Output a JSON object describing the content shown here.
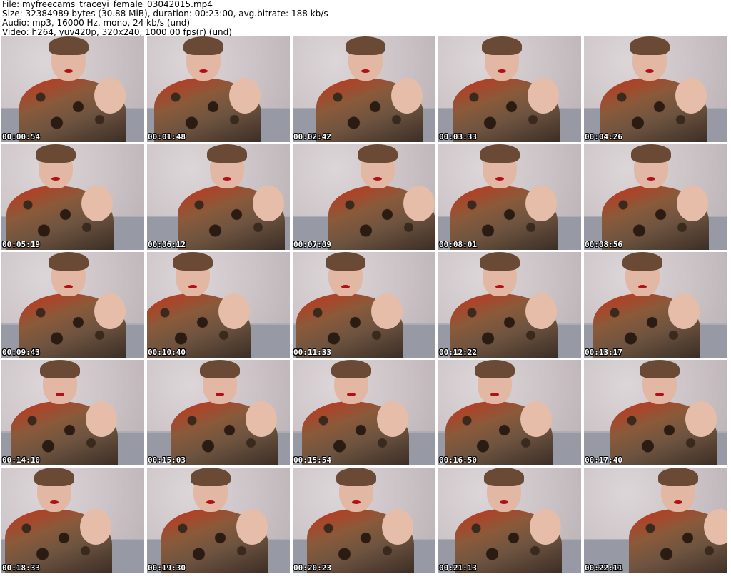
{
  "header": {
    "file_line": "File: myfreecams_traceyi_female_03042015.mp4",
    "size_line": "Size: 32384989 bytes (30.88 MiB), duration: 00:23:00, avg.bitrate: 188 kb/s",
    "audio_line": "Audio: mp3, 16000 Hz, mono, 24 kb/s (und)",
    "video_line": "Video: h264, yuv420p, 320x240, 1000.00 fps(r) (und)"
  },
  "thumbnails": [
    {
      "timestamp": "00:00:54"
    },
    {
      "timestamp": "00:01:48"
    },
    {
      "timestamp": "00:02:42"
    },
    {
      "timestamp": "00:03:33"
    },
    {
      "timestamp": "00:04:26"
    },
    {
      "timestamp": "00:05:19"
    },
    {
      "timestamp": "00:06:12"
    },
    {
      "timestamp": "00:07:09"
    },
    {
      "timestamp": "00:08:01"
    },
    {
      "timestamp": "00:08:56"
    },
    {
      "timestamp": "00:09:43"
    },
    {
      "timestamp": "00:10:40"
    },
    {
      "timestamp": "00:11:33"
    },
    {
      "timestamp": "00:12:22"
    },
    {
      "timestamp": "00:13:17"
    },
    {
      "timestamp": "00:14:10"
    },
    {
      "timestamp": "00:15:03"
    },
    {
      "timestamp": "00:15:54"
    },
    {
      "timestamp": "00:16:50"
    },
    {
      "timestamp": "00:17:40"
    },
    {
      "timestamp": "00:18:33"
    },
    {
      "timestamp": "00:19:30"
    },
    {
      "timestamp": "00:20:23"
    },
    {
      "timestamp": "00:21:13"
    },
    {
      "timestamp": "00:22:11"
    }
  ]
}
